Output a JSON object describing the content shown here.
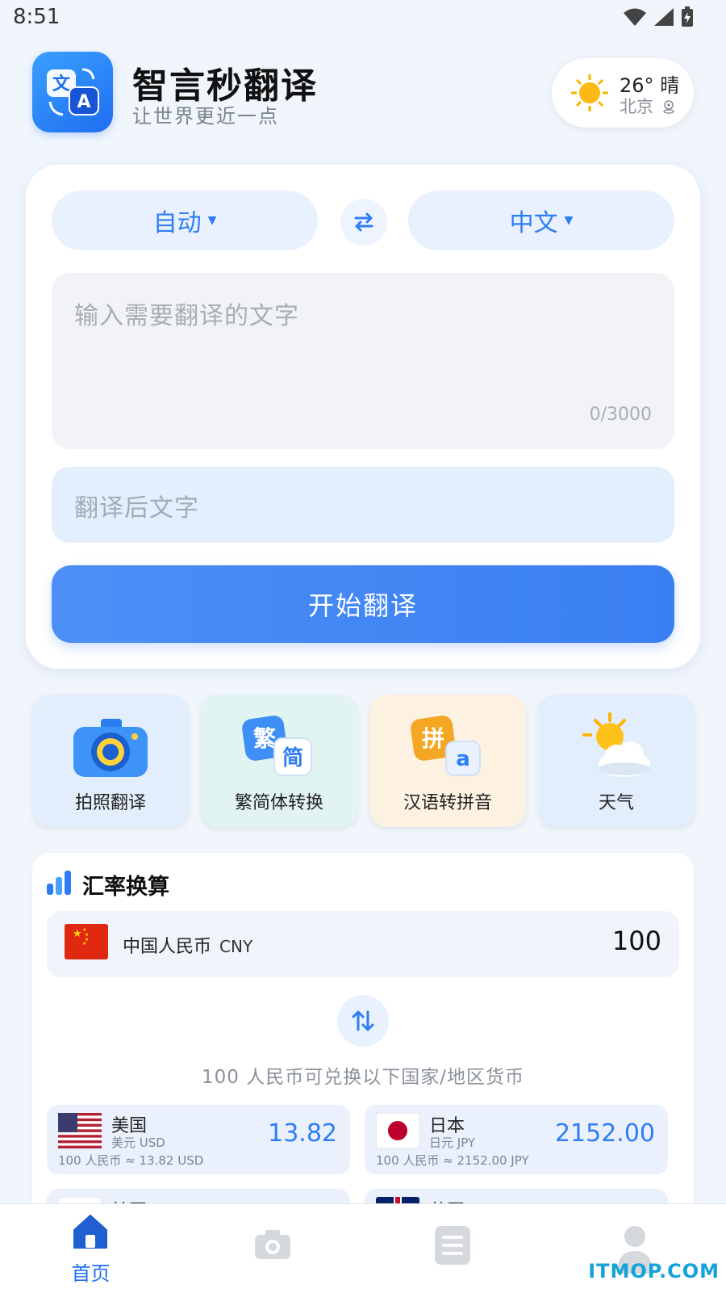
{
  "status_bar": {
    "time": "8:51"
  },
  "header": {
    "app_name": "智言秒翻译",
    "slogan": "让世界更近一点",
    "weather": {
      "temp": "26°",
      "condition": "晴",
      "city": "北京"
    }
  },
  "translate": {
    "source_lang": "自动",
    "target_lang": "中文",
    "input_placeholder": "输入需要翻译的文字",
    "char_count": "0/3000",
    "output_placeholder": "翻译后文字",
    "start_button": "开始翻译"
  },
  "tools": [
    {
      "label": "拍照翻译",
      "icon": "camera-icon",
      "bg": "#e3eefc"
    },
    {
      "label": "繁简体转换",
      "icon": "traditional-simplified-icon",
      "bg": "#e1f4f2"
    },
    {
      "label": "汉语转拼音",
      "icon": "pinyin-icon",
      "bg": "#fdf1e1"
    },
    {
      "label": "天气",
      "icon": "weather-icon",
      "bg": "#e3eefc"
    }
  ],
  "exchange": {
    "title": "汇率换算",
    "base": {
      "name": "中国人民币",
      "code": "CNY",
      "amount": "100"
    },
    "hint": "100 人民币可兑换以下国家/地区货币",
    "items": [
      {
        "country": "美国",
        "unit": "美元 USD",
        "note": "100 人民币 ≈ 13.82 USD",
        "value": "13.82"
      },
      {
        "country": "日本",
        "unit": "日元 JPY",
        "note": "100 人民币 ≈ 2152.00 JPY",
        "value": "2152.00"
      }
    ],
    "partial_items": [
      {
        "country": "韩国"
      },
      {
        "country": "英国"
      }
    ]
  },
  "nav": [
    {
      "label": "首页",
      "icon": "home-icon",
      "active": true
    },
    {
      "label": "",
      "icon": "camera-icon",
      "active": false
    },
    {
      "label": "",
      "icon": "document-icon",
      "active": false
    },
    {
      "label": "",
      "icon": "user-icon",
      "active": false
    }
  ],
  "watermark": "ITMOP.COM",
  "colors": {
    "primary": "#2f7df5",
    "background": "#f1f6fd",
    "card": "#ffffff"
  }
}
